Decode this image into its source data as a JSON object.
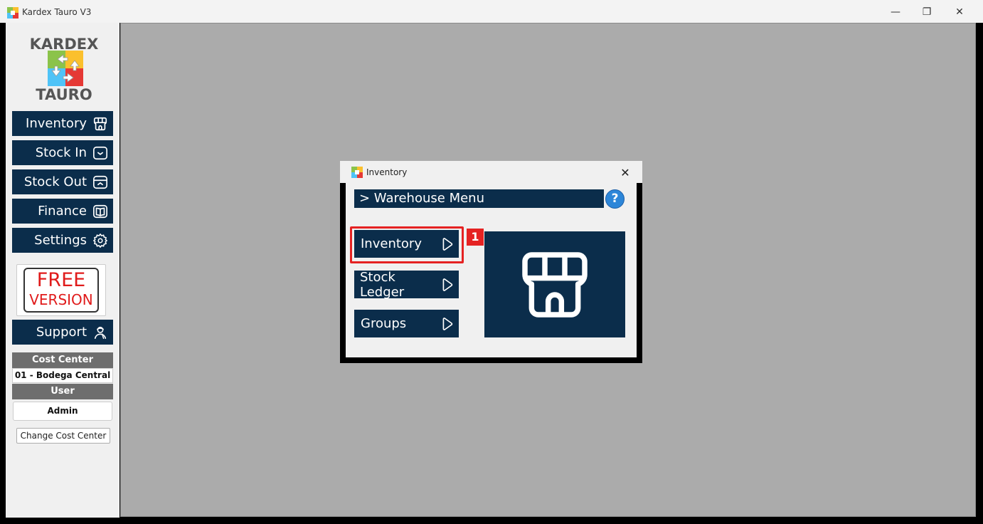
{
  "window": {
    "title": "Kardex Tauro V3",
    "controls": {
      "minimize": "—",
      "maximize": "❐",
      "close": "✕"
    }
  },
  "logo": {
    "top": "KARDEX",
    "bottom": "TAURO"
  },
  "sidebar": {
    "items": [
      {
        "label": "Inventory",
        "icon": "store-icon"
      },
      {
        "label": "Stock In",
        "icon": "tray-in-icon"
      },
      {
        "label": "Stock Out",
        "icon": "tray-out-icon"
      },
      {
        "label": "Finance",
        "icon": "book-icon"
      },
      {
        "label": "Settings",
        "icon": "gear-icon"
      }
    ],
    "free_badge": {
      "line1": "FREE",
      "line2": "VERSION"
    },
    "support": {
      "label": "Support",
      "icon": "support-agent-icon"
    },
    "cost_center_label": "Cost Center",
    "cost_center_value": "01 - Bodega Central",
    "user_label": "User",
    "user_value": "Admin",
    "change_button": "Change Cost Center"
  },
  "dialog": {
    "title": "Inventory",
    "close": "✕",
    "header": "> Warehouse Menu",
    "help": "?",
    "buttons": [
      {
        "label": "Inventory",
        "icon": "play-icon"
      },
      {
        "label": "Stock Ledger",
        "icon": "play-icon"
      },
      {
        "label": "Groups",
        "icon": "play-icon"
      }
    ],
    "annotation": "1",
    "preview_icon": "store-icon"
  },
  "colors": {
    "navy": "#0b2d4b",
    "highlight_red": "#e52222",
    "workspace_gray": "#ababab",
    "help_blue": "#2d86d8"
  }
}
